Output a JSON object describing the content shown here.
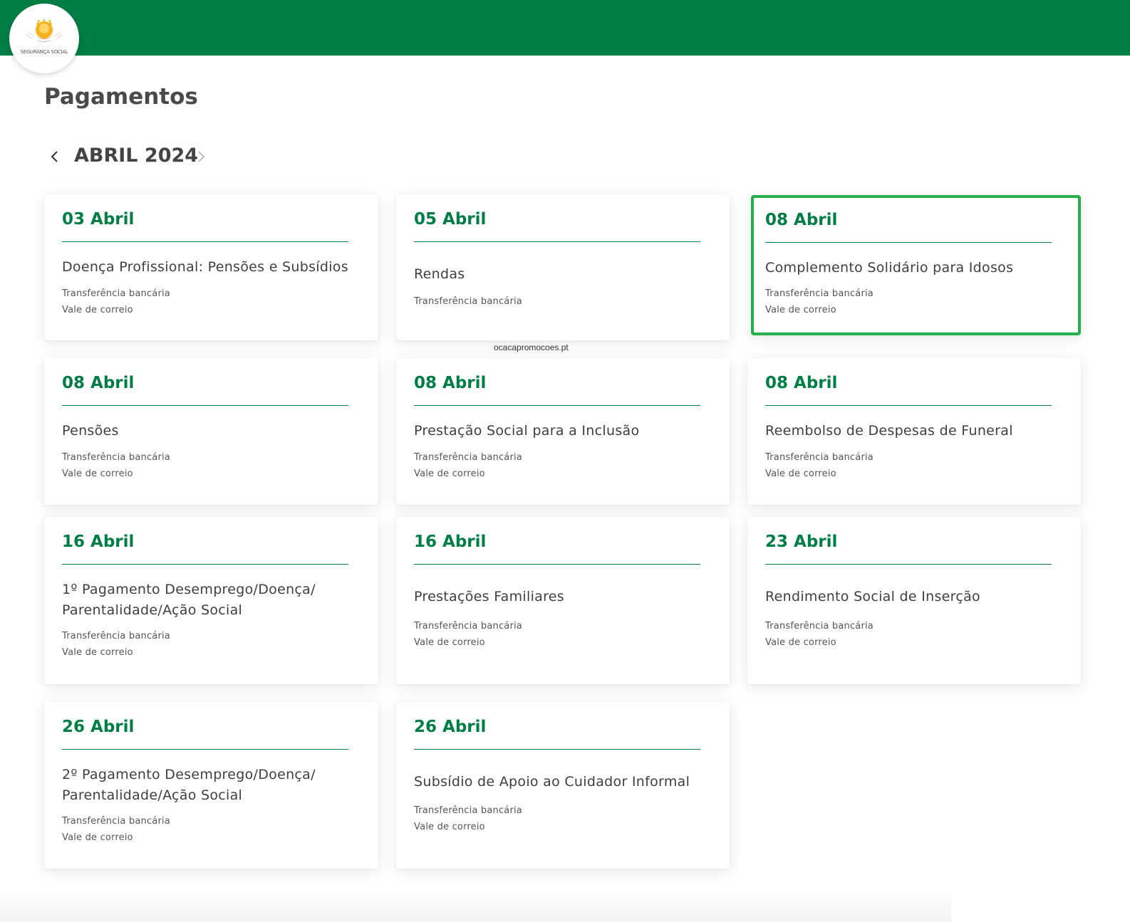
{
  "header": {
    "logo_text": "SEGURANÇA SOCIAL",
    "bar_color": "#007e45"
  },
  "page": {
    "title": "Pagamentos"
  },
  "calendar": {
    "month_label": "ABRIL 2024",
    "prev_icon": "chevron-left-icon",
    "next_icon": "chevron-right-icon"
  },
  "watermark": "ocacapromocoes.pt",
  "colors": {
    "accent": "#007e45",
    "highlight_border": "#26b04b"
  },
  "cards": [
    {
      "date": "03 Abril",
      "title": "Doença Profissional: Pensões e Subsídios",
      "methods": [
        "Transferência bancária",
        "Vale de correio"
      ]
    },
    {
      "date": "05 Abril",
      "title": "Rendas",
      "methods": [
        "Transferência bancária"
      ]
    },
    {
      "date": "08 Abril",
      "title": "Complemento Solidário para Idosos",
      "methods": [
        "Transferência bancária",
        "Vale de correio"
      ],
      "highlighted": true
    },
    {
      "date": "08 Abril",
      "title": "Pensões",
      "methods": [
        "Transferência bancária",
        "Vale de correio"
      ]
    },
    {
      "date": "08 Abril",
      "title": "Prestação Social para a Inclusão",
      "methods": [
        "Transferência bancária",
        "Vale de correio"
      ]
    },
    {
      "date": "08 Abril",
      "title": "Reembolso de Despesas de Funeral",
      "methods": [
        "Transferência bancária",
        "Vale de correio"
      ]
    },
    {
      "date": "16 Abril",
      "title_lines": [
        "1º Pagamento Desemprego/Doença/",
        "Parentalidade/Ação Social"
      ],
      "methods": [
        "Transferência bancária",
        "Vale de correio"
      ]
    },
    {
      "date": "16 Abril",
      "title": "Prestações Familiares",
      "methods": [
        "Transferência bancária",
        "Vale de correio"
      ]
    },
    {
      "date": "23 Abril",
      "title": "Rendimento Social de Inserção",
      "methods": [
        "Transferência bancária",
        "Vale de correio"
      ]
    },
    {
      "date": "26 Abril",
      "title_lines": [
        "2º Pagamento Desemprego/Doença/",
        "Parentalidade/Ação Social"
      ],
      "methods": [
        "Transferência bancária",
        "Vale de correio"
      ]
    },
    {
      "date": "26 Abril",
      "title": "Subsídio de Apoio ao Cuidador Informal",
      "methods": [
        "Transferência bancária",
        "Vale de correio"
      ]
    }
  ]
}
